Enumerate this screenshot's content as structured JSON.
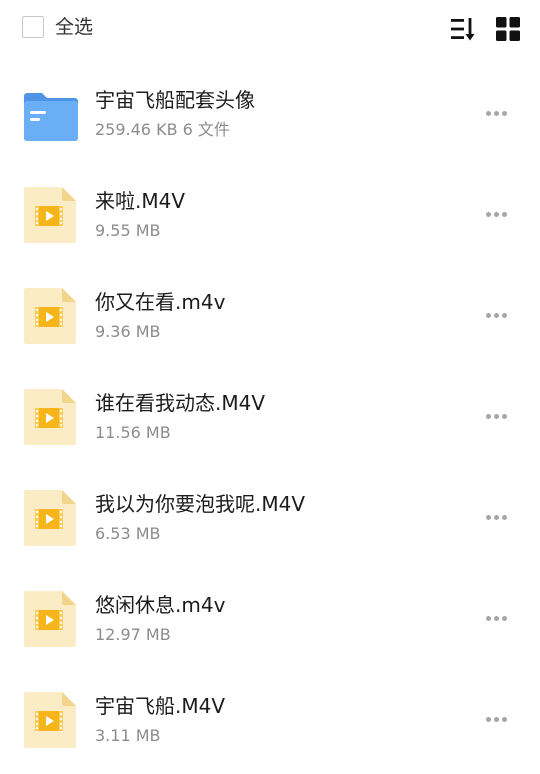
{
  "toolbar": {
    "select_all_label": "全选",
    "sort_icon": "sort-icon",
    "grid_icon": "grid-view-icon"
  },
  "colors": {
    "folder": "#5aa2f0",
    "video_file_bg": "#fbecc6",
    "video_badge": "#f7b51c",
    "more_dots": "#a6a6a6",
    "meta_text": "#8c8c8c"
  },
  "files": [
    {
      "type": "folder",
      "icon": "folder-icon",
      "name": "宇宙飞船配套头像",
      "meta": "259.46 KB 6 文件"
    },
    {
      "type": "video",
      "icon": "video-file-icon",
      "name": "来啦.M4V",
      "meta": "9.55 MB"
    },
    {
      "type": "video",
      "icon": "video-file-icon",
      "name": "你又在看.m4v",
      "meta": "9.36 MB"
    },
    {
      "type": "video",
      "icon": "video-file-icon",
      "name": "谁在看我动态.M4V",
      "meta": "11.56 MB"
    },
    {
      "type": "video",
      "icon": "video-file-icon",
      "name": "我以为你要泡我呢.M4V",
      "meta": "6.53 MB"
    },
    {
      "type": "video",
      "icon": "video-file-icon",
      "name": "悠闲休息.m4v",
      "meta": "12.97 MB"
    },
    {
      "type": "video",
      "icon": "video-file-icon",
      "name": "宇宙飞船.M4V",
      "meta": "3.11 MB"
    }
  ]
}
